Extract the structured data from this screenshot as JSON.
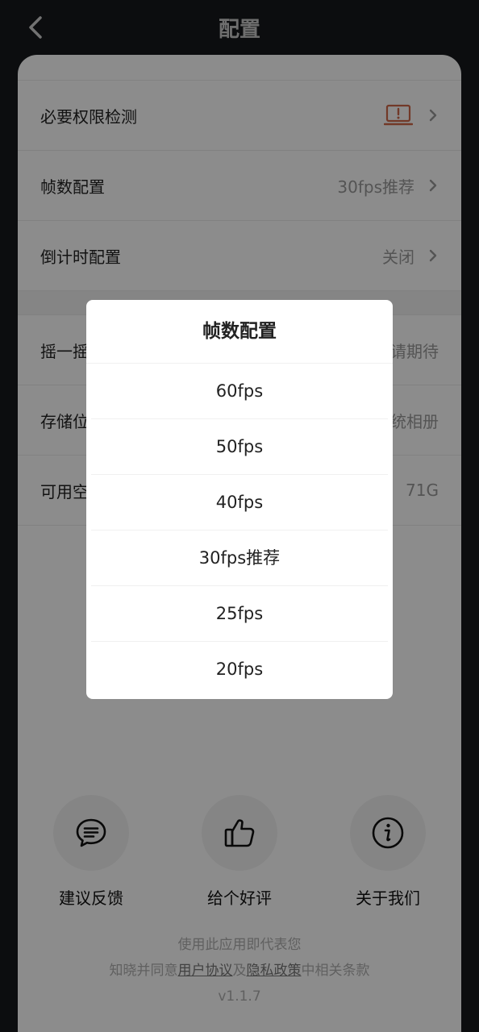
{
  "header": {
    "title": "配置",
    "back_icon": "chevron-left-icon"
  },
  "settings": {
    "rows": [
      {
        "label": "必要权限检测",
        "value": "",
        "icon": "laptop-warning-icon",
        "icon_color": "#d0684a"
      },
      {
        "label": "帧数配置",
        "value": "30fps推荐"
      },
      {
        "label": "倒计时配置",
        "value": "关闭"
      },
      {
        "label": "摇一摇",
        "value": "请期待"
      },
      {
        "label": "存储位",
        "value": "统相册"
      },
      {
        "label": "可用空",
        "value": "71G"
      }
    ]
  },
  "actions": [
    {
      "label": "建议反馈",
      "icon": "chat-bubble-icon"
    },
    {
      "label": "给个好评",
      "icon": "thumbs-up-icon"
    },
    {
      "label": "关于我们",
      "icon": "info-icon"
    }
  ],
  "legal": {
    "line1": "使用此应用即代表您",
    "line2_prefix": "知晓并同意",
    "user_agreement": "用户协议",
    "and": "及",
    "privacy_policy": "隐私政策",
    "line2_suffix": "中相关条款",
    "version": "v1.1.7"
  },
  "dialog": {
    "title": "帧数配置",
    "options": [
      "60fps",
      "50fps",
      "40fps",
      "30fps推荐",
      "25fps",
      "20fps"
    ]
  },
  "colors": {
    "background": "#17181c",
    "card": "#ffffff",
    "warning": "#d0684a"
  }
}
